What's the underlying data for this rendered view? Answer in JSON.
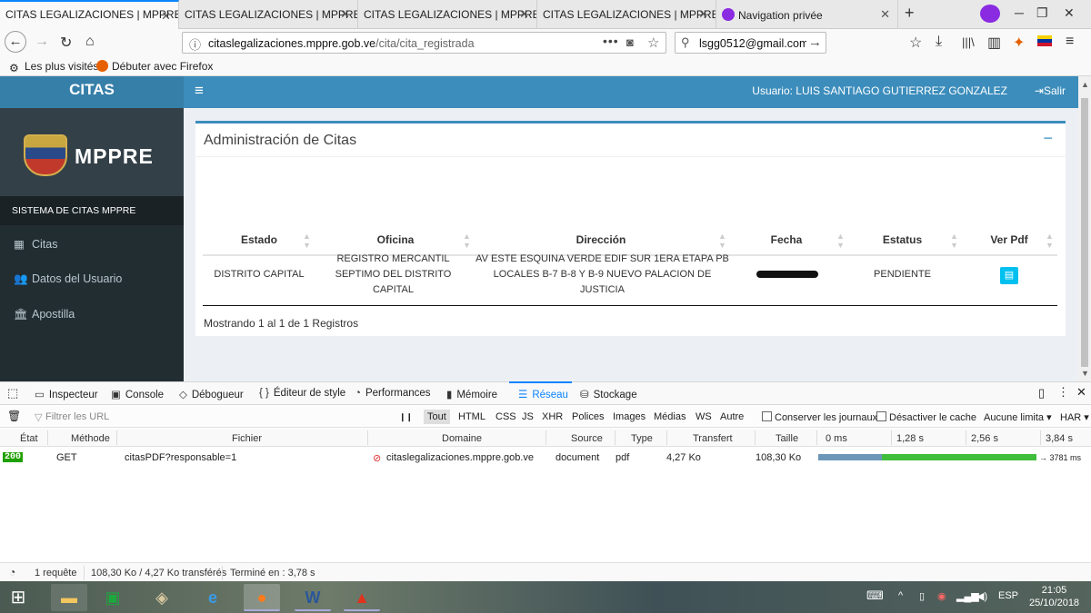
{
  "browser": {
    "tabs": [
      {
        "label": "CITAS LEGALIZACIONES | MPPRE",
        "active": true
      },
      {
        "label": "CITAS LEGALIZACIONES | MPPRE",
        "active": false
      },
      {
        "label": "CITAS LEGALIZACIONES | MPPRE",
        "active": false
      },
      {
        "label": "CITAS LEGALIZACIONES | MPPRE",
        "active": false
      },
      {
        "label": "Navigation privée",
        "active": false
      }
    ],
    "new_tab": "+",
    "url_domain": "citaslegalizaciones.mppre.gob.ve",
    "url_path": "/cita/cita_registrada",
    "search_value": "lsgg0512@gmail.com",
    "bookmarks": [
      "Les plus visités",
      "Débuter avec Firefox"
    ]
  },
  "app": {
    "brand": "CITAS",
    "user_label": "Usuario: LUIS SANTIAGO GUTIERREZ GONZALEZ",
    "logout": "Salir",
    "logo_text": "MPPRE",
    "sidebar_header": "SISTEMA DE CITAS MPPRE",
    "sidebar_items": [
      {
        "label": "Citas",
        "icon": "calendar-icon"
      },
      {
        "label": "Datos del Usuario",
        "icon": "users-icon"
      },
      {
        "label": "Apostilla",
        "icon": "bank-icon"
      }
    ],
    "box_title": "Administración de Citas",
    "collapse": "−",
    "table": {
      "headers": [
        "Estado",
        "Oficina",
        "Dirección",
        "Fecha",
        "Estatus",
        "Ver Pdf"
      ],
      "row": {
        "estado": "DISTRITO CAPITAL",
        "oficina": [
          "REGISTRO MERCANTIL",
          "SEPTIMO DEL DISTRITO",
          "CAPITAL"
        ],
        "direccion": [
          "AV ESTE ESQUINA VERDE EDIF SUR 1ERA ETAPA PB",
          "LOCALES B-7 B-8 Y B-9 NUEVO PALACION DE",
          "JUSTICIA"
        ],
        "estatus": "PENDIENTE"
      }
    },
    "info": "Mostrando 1 al 1 de 1 Registros"
  },
  "devtools": {
    "tabs": [
      "Inspecteur",
      "Console",
      "Débogueur",
      "Éditeur de style",
      "Performances",
      "Mémoire",
      "Réseau",
      "Stockage"
    ],
    "selected_tab": "Réseau",
    "filter_placeholder": "Filtrer les URL",
    "pause": "❙❙",
    "filters": [
      "Tout",
      "HTML",
      "CSS",
      "JS",
      "XHR",
      "Polices",
      "Images",
      "Médias",
      "WS",
      "Autre"
    ],
    "persist_logs": "Conserver les journaux",
    "disable_cache": "Désactiver le cache",
    "throttle": "Aucune limita ▾",
    "har": "HAR ▾",
    "columns": [
      "État",
      "Méthode",
      "Fichier",
      "Domaine",
      "Source",
      "Type",
      "Transfert",
      "Taille"
    ],
    "timeline_ticks": [
      "0 ms",
      "1,28 s",
      "2,56 s",
      "3,84 s"
    ],
    "request": {
      "status": "200",
      "method": "GET",
      "file": "citasPDF?responsable=1",
      "domain": "citaslegalizaciones.mppre.gob.ve",
      "source": "document",
      "type": "pdf",
      "transfer": "4,27 Ko",
      "size": "108,30 Ko",
      "duration": "→ 3781 ms"
    },
    "footer": {
      "requests": "1 requête",
      "sizes": "108,30 Ko / 4,27 Ko transférés",
      "finished": "Terminé en : 3,78 s"
    }
  },
  "taskbar": {
    "lang": "ESP",
    "time": "21:05",
    "date": "25/10/2018"
  }
}
